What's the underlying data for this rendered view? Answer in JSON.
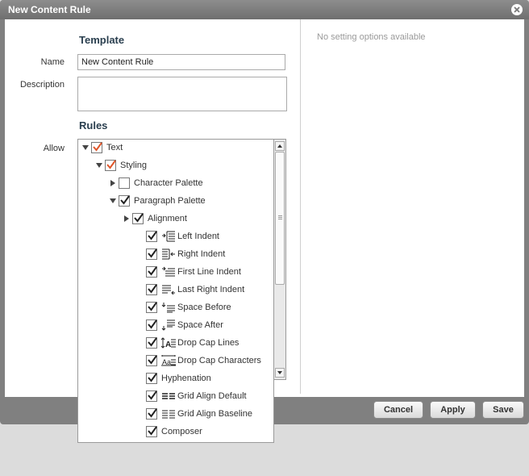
{
  "dialog": {
    "title": "New Content Rule",
    "close_icon": "close-icon"
  },
  "template": {
    "heading": "Template",
    "name_label": "Name",
    "name_value": "New Content Rule",
    "description_label": "Description",
    "description_value": ""
  },
  "rules": {
    "heading": "Rules",
    "allow_label": "Allow",
    "tree": [
      {
        "label": "Text",
        "level": 0,
        "expander": "expanded",
        "checked": true,
        "partial": true,
        "icon": ""
      },
      {
        "label": "Styling",
        "level": 1,
        "expander": "expanded",
        "checked": true,
        "partial": true,
        "icon": ""
      },
      {
        "label": "Character Palette",
        "level": 2,
        "expander": "collapsed",
        "checked": false,
        "partial": false,
        "icon": ""
      },
      {
        "label": "Paragraph Palette",
        "level": 2,
        "expander": "expanded",
        "checked": true,
        "partial": false,
        "icon": ""
      },
      {
        "label": "Alignment",
        "level": 3,
        "expander": "collapsed",
        "checked": true,
        "partial": false,
        "icon": ""
      },
      {
        "label": "Left Indent",
        "level": 4,
        "expander": "none",
        "checked": true,
        "partial": false,
        "icon": "left-indent-icon"
      },
      {
        "label": "Right Indent",
        "level": 4,
        "expander": "none",
        "checked": true,
        "partial": false,
        "icon": "right-indent-icon"
      },
      {
        "label": "First Line Indent",
        "level": 4,
        "expander": "none",
        "checked": true,
        "partial": false,
        "icon": "first-line-indent-icon"
      },
      {
        "label": "Last Right Indent",
        "level": 4,
        "expander": "none",
        "checked": true,
        "partial": false,
        "icon": "last-right-indent-icon"
      },
      {
        "label": "Space Before",
        "level": 4,
        "expander": "none",
        "checked": true,
        "partial": false,
        "icon": "space-before-icon"
      },
      {
        "label": "Space After",
        "level": 4,
        "expander": "none",
        "checked": true,
        "partial": false,
        "icon": "space-after-icon"
      },
      {
        "label": "Drop Cap Lines",
        "level": 4,
        "expander": "none",
        "checked": true,
        "partial": false,
        "icon": "drop-cap-lines-icon"
      },
      {
        "label": "Drop Cap Characters",
        "level": 4,
        "expander": "none",
        "checked": true,
        "partial": false,
        "icon": "drop-cap-characters-icon"
      },
      {
        "label": "Hyphenation",
        "level": 4,
        "expander": "none",
        "checked": true,
        "partial": false,
        "icon": ""
      },
      {
        "label": "Grid Align Default",
        "level": 4,
        "expander": "none",
        "checked": true,
        "partial": false,
        "icon": "grid-align-default-icon"
      },
      {
        "label": "Grid Align Baseline",
        "level": 4,
        "expander": "none",
        "checked": true,
        "partial": false,
        "icon": "grid-align-baseline-icon"
      },
      {
        "label": "Composer",
        "level": 4,
        "expander": "none",
        "checked": true,
        "partial": false,
        "icon": ""
      }
    ]
  },
  "settings_panel": {
    "message": "No setting options available"
  },
  "buttons": {
    "cancel": "Cancel",
    "apply": "Apply",
    "save": "Save"
  },
  "colors": {
    "check_partial": "#e0562a",
    "check_full": "#222222",
    "heading": "#2a3f4f"
  }
}
